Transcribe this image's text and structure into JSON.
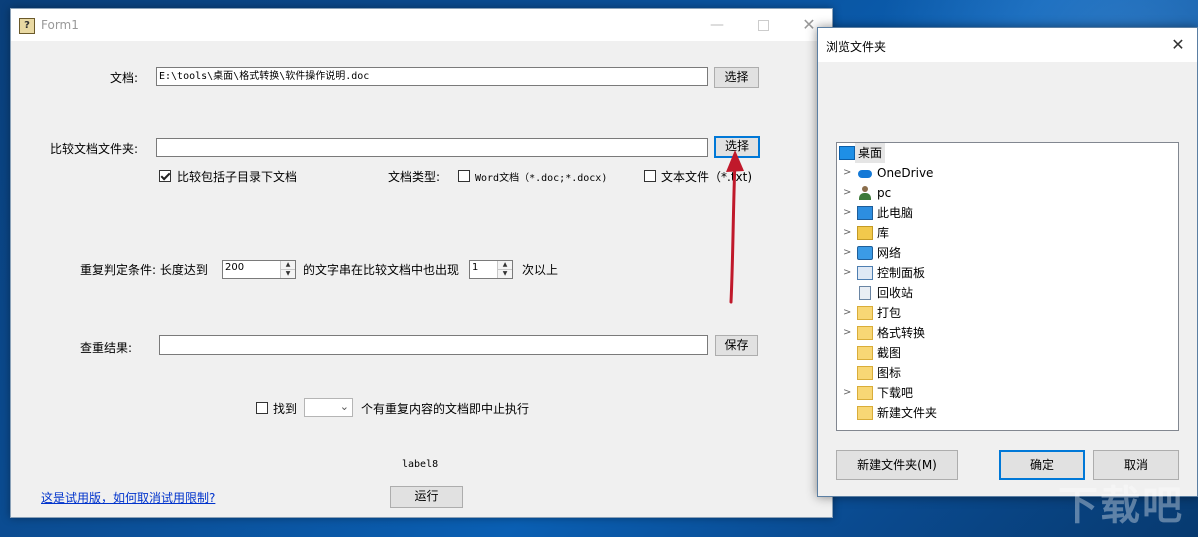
{
  "form": {
    "title": "Form1",
    "doc_label": "文档:",
    "doc_path": "E:\\tools\\桌面\\格式转换\\软件操作说明.doc",
    "choose_label": "选择",
    "compare_folder_label": "比较文档文件夹:",
    "compare_folder_value": "",
    "choose_label2": "选择",
    "include_subdirs_label": "比较包括子目录下文档",
    "include_subdirs_checked": true,
    "doc_type_label": "文档类型:",
    "word_type_label": "Word文档（*.doc;*.docx)",
    "text_type_label": "文本文件（*.txt)",
    "repeat_condition_label": "重复判定条件: 长度达到",
    "length_value": "200",
    "appear_text": "的文字串在比较文档中也出现",
    "times_value": "1",
    "times_suffix": "次以上",
    "result_label": "查重结果:",
    "result_value": "",
    "save_label": "保存",
    "find_label": "找到",
    "find_suffix": "个有重复内容的文档即中止执行",
    "status_label": "label8",
    "trial_link": "这是试用版，如何取消试用限制?",
    "run_label": "运行"
  },
  "dialog": {
    "title": "浏览文件夹",
    "tree_items": [
      {
        "label": "桌面",
        "icon": "desktop-icon",
        "expandable": false,
        "selected": true,
        "indent": 0
      },
      {
        "label": "OneDrive",
        "icon": "cloud-icon",
        "expandable": true,
        "selected": false,
        "indent": 1
      },
      {
        "label": "pc",
        "icon": "user-icon",
        "expandable": true,
        "selected": false,
        "indent": 1
      },
      {
        "label": "此电脑",
        "icon": "computer-icon",
        "expandable": true,
        "selected": false,
        "indent": 1
      },
      {
        "label": "库",
        "icon": "library-icon",
        "expandable": true,
        "selected": false,
        "indent": 1
      },
      {
        "label": "网络",
        "icon": "network-icon",
        "expandable": true,
        "selected": false,
        "indent": 1
      },
      {
        "label": "控制面板",
        "icon": "control-panel-icon",
        "expandable": true,
        "selected": false,
        "indent": 1
      },
      {
        "label": "回收站",
        "icon": "recycle-bin-icon",
        "expandable": false,
        "selected": false,
        "indent": 1
      },
      {
        "label": "打包",
        "icon": "folder-icon",
        "expandable": true,
        "selected": false,
        "indent": 1
      },
      {
        "label": "格式转换",
        "icon": "folder-icon",
        "expandable": true,
        "selected": false,
        "indent": 1
      },
      {
        "label": "截图",
        "icon": "folder-icon",
        "expandable": false,
        "selected": false,
        "indent": 1
      },
      {
        "label": "图标",
        "icon": "folder-icon",
        "expandable": false,
        "selected": false,
        "indent": 1
      },
      {
        "label": "下载吧",
        "icon": "folder-icon",
        "expandable": true,
        "selected": false,
        "indent": 1
      },
      {
        "label": "新建文件夹",
        "icon": "folder-icon",
        "expandable": false,
        "selected": false,
        "indent": 1
      }
    ],
    "new_folder_label": "新建文件夹(M)",
    "ok_label": "确定",
    "cancel_label": "取消"
  },
  "colors": {
    "focus_blue": "#0078d7",
    "annotation_red": "#c0192b",
    "link_blue": "#0033cc"
  }
}
